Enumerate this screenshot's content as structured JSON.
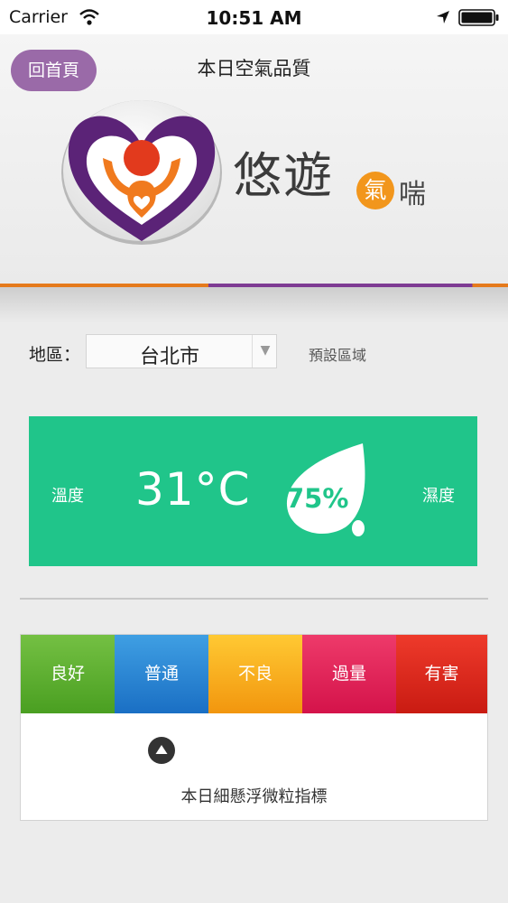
{
  "status_bar": {
    "carrier": "Carrier",
    "time": "10:51 AM",
    "icons": [
      "wifi-icon",
      "location-arrow-icon",
      "battery-icon"
    ]
  },
  "header": {
    "home_label": "回首頁",
    "title": "本日空氣品質",
    "brand_main": "悠遊",
    "brand_badge": "氣",
    "brand_tail": "喘",
    "logo": "heart-hands-logo",
    "accent_colors": {
      "orange": "#e57a1c",
      "purple": "#7e3b93"
    }
  },
  "region": {
    "label": "地區：",
    "selected": "台北市",
    "default_link": "預設區域"
  },
  "weather": {
    "temp_label": "溫度",
    "temp_value": "31°C",
    "humidity_value": "75%",
    "humidity_label": "濕度",
    "color": "#20c58a"
  },
  "air_quality": {
    "levels": [
      {
        "label": "良好",
        "color": "#4a9f21"
      },
      {
        "label": "普通",
        "color": "#1a6fc4"
      },
      {
        "label": "不良",
        "color": "#f2960e"
      },
      {
        "label": "過量",
        "color": "#d4134a"
      },
      {
        "label": "有害",
        "color": "#c91b12"
      }
    ],
    "current_level_index": 1,
    "marker_icon": "triangle-up-icon",
    "caption": "本日細懸浮微粒指標"
  }
}
